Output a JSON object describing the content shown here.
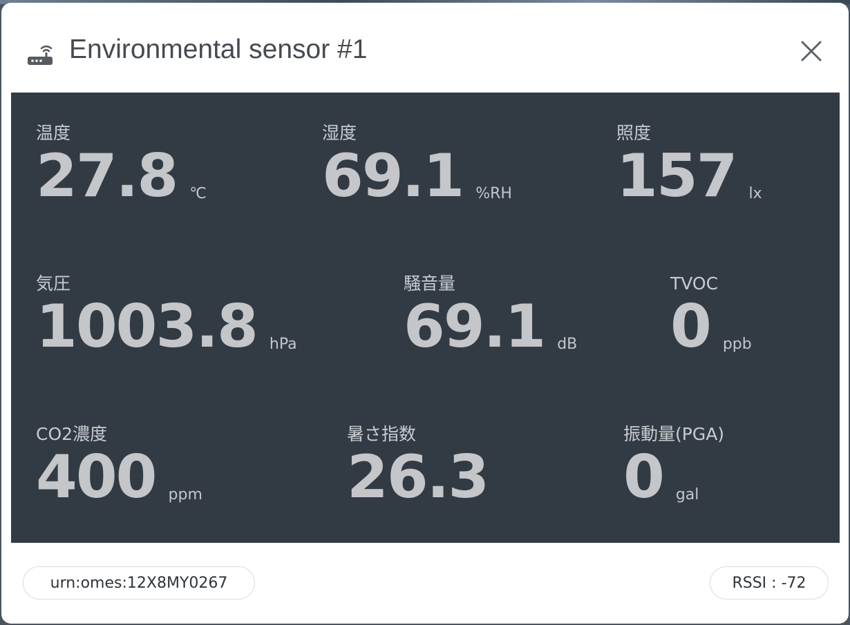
{
  "dialog": {
    "title": "Environmental sensor #1",
    "icons": {
      "device": "router-icon",
      "close": "close-icon"
    }
  },
  "metrics": [
    {
      "label": "温度",
      "value": "27.8",
      "unit": "℃"
    },
    {
      "label": "湿度",
      "value": "69.1",
      "unit": "%RH"
    },
    {
      "label": "照度",
      "value": "157",
      "unit": "lx"
    },
    {
      "label": "気圧",
      "value": "1003.8",
      "unit": "hPa"
    },
    {
      "label": "騒音量",
      "value": "69.1",
      "unit": "dB"
    },
    {
      "label": "TVOC",
      "value": "0",
      "unit": "ppb"
    },
    {
      "label": "CO2濃度",
      "value": "400",
      "unit": "ppm"
    },
    {
      "label": "暑さ指数",
      "value": "26.3",
      "unit": ""
    },
    {
      "label": "振動量(PGA)",
      "value": "0",
      "unit": "gal"
    }
  ],
  "footer": {
    "device_urn": "urn:omes:12X8MY0267",
    "rssi": "RSSI : -72"
  },
  "colors": {
    "panel_bg": "#323b44",
    "value_text": "#c4c6c9",
    "title_text": "#444a50"
  }
}
